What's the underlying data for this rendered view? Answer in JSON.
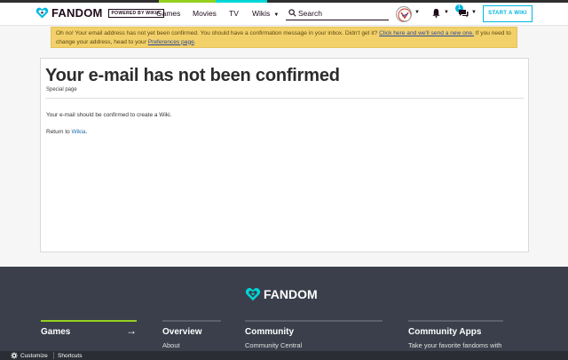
{
  "colors": {
    "accent": "#00b7e0",
    "alert_bg": "#f3d16a",
    "footer_bg": "#3a3f4b",
    "games_accent": "#94d11f"
  },
  "navbar": {
    "brand": "FANDOM",
    "powered": "POWERED BY WIKIA",
    "links": {
      "games": "Games",
      "movies": "Movies",
      "tv": "TV",
      "wikis": "Wikis"
    },
    "search_placeholder": "Search",
    "messages_badge": "1",
    "start_wiki": "START A WIKI"
  },
  "alert": {
    "text_1": "Oh no! Your email address has not yet been confirmed. You should have a confirmation message in your inbox. Didn't get it? ",
    "link_resend": "Click here and we'll send a new one.",
    "text_2": " If you need to change your address, head to your ",
    "link_prefs": "Preferences page",
    "text_3": "."
  },
  "page": {
    "title": "Your e-mail has not been confirmed",
    "subtitle": "Special page",
    "body": "Your e-mail should be confirmed to create a Wiki.",
    "return_prefix": "Return to ",
    "return_link": "Wikia",
    "return_suffix": "."
  },
  "footer": {
    "brand": "FANDOM",
    "games": {
      "heading": "Games",
      "arrow": "→"
    },
    "overview": {
      "heading": "Overview",
      "first": "About"
    },
    "community": {
      "heading": "Community",
      "first": "Community Central"
    },
    "apps": {
      "heading": "Community Apps",
      "first": "Take your favorite fandoms with"
    }
  },
  "bottombar": {
    "customize": "Customize",
    "shortcuts": "Shortcuts"
  },
  "icons": [
    "fandom-heart-icon",
    "search-icon",
    "avatar",
    "bell-icon",
    "messages-icon",
    "gear-icon"
  ]
}
